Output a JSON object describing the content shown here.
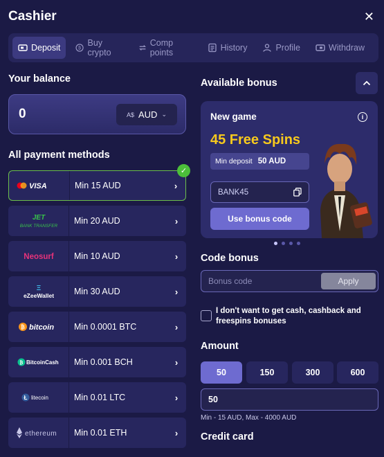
{
  "header": {
    "title": "Cashier",
    "close_glyph": "✕"
  },
  "tabs": [
    {
      "label": "Deposit",
      "icon": "deposit-icon",
      "active": true
    },
    {
      "label": "Buy crypto",
      "icon": "bitcoin-coin-icon"
    },
    {
      "label": "Comp points",
      "icon": "exchange-icon"
    },
    {
      "label": "History",
      "icon": "history-icon"
    },
    {
      "label": "Profile",
      "icon": "user-icon"
    },
    {
      "label": "Withdraw",
      "icon": "withdraw-icon"
    }
  ],
  "balance": {
    "heading": "Your balance",
    "value": "0",
    "currency_symbol": "A$",
    "currency": "AUD"
  },
  "payment": {
    "heading": "All payment methods",
    "methods": [
      {
        "name": "Mastercard Visa",
        "logo_text": "VISA",
        "min": "Min 15 AUD",
        "selected": true
      },
      {
        "name": "Jet Bank Transfer",
        "logo_text": "JET",
        "logo_sub": "BANK TRANSFER",
        "min": "Min 20 AUD"
      },
      {
        "name": "Neosurf",
        "logo_text": "Neosurf",
        "min": "Min 10 AUD"
      },
      {
        "name": "eZeeWallet",
        "logo_text": "eZeeWallet",
        "min": "Min 30 AUD"
      },
      {
        "name": "bitcoin",
        "logo_text": "bitcoin",
        "min": "Min 0.0001 BTC"
      },
      {
        "name": "BitcoinCash",
        "logo_text": "BitcoinCash",
        "min": "Min 0.001 BCH"
      },
      {
        "name": "litecoin",
        "logo_text": "litecoin",
        "min": "Min 0.01 LTC"
      },
      {
        "name": "ethereum",
        "logo_text": "ethereum",
        "min": "Min 0.01 ETH"
      }
    ]
  },
  "bonus": {
    "heading": "Available bonus",
    "card_title": "New game",
    "offer": "45 Free Spins",
    "min_deposit_label": "Min deposit",
    "min_deposit_value": "50 AUD",
    "code": "BANK45",
    "use_button": "Use bonus code"
  },
  "code_bonus": {
    "heading": "Code bonus",
    "placeholder": "Bonus code",
    "apply": "Apply"
  },
  "opt_out": {
    "label": "I don't want to get cash, cashback and freespins bonuses"
  },
  "amount": {
    "heading": "Amount",
    "presets": [
      "50",
      "150",
      "300",
      "600"
    ],
    "active_preset": "50",
    "value": "50",
    "hint": "Min - 15 AUD, Max - 4000 AUD"
  },
  "credit_card": {
    "heading": "Credit card"
  },
  "colors": {
    "background": "#1b1a45",
    "accent": "#6e6bd0",
    "gold": "#f7c91d",
    "success": "#4cbf3a"
  }
}
